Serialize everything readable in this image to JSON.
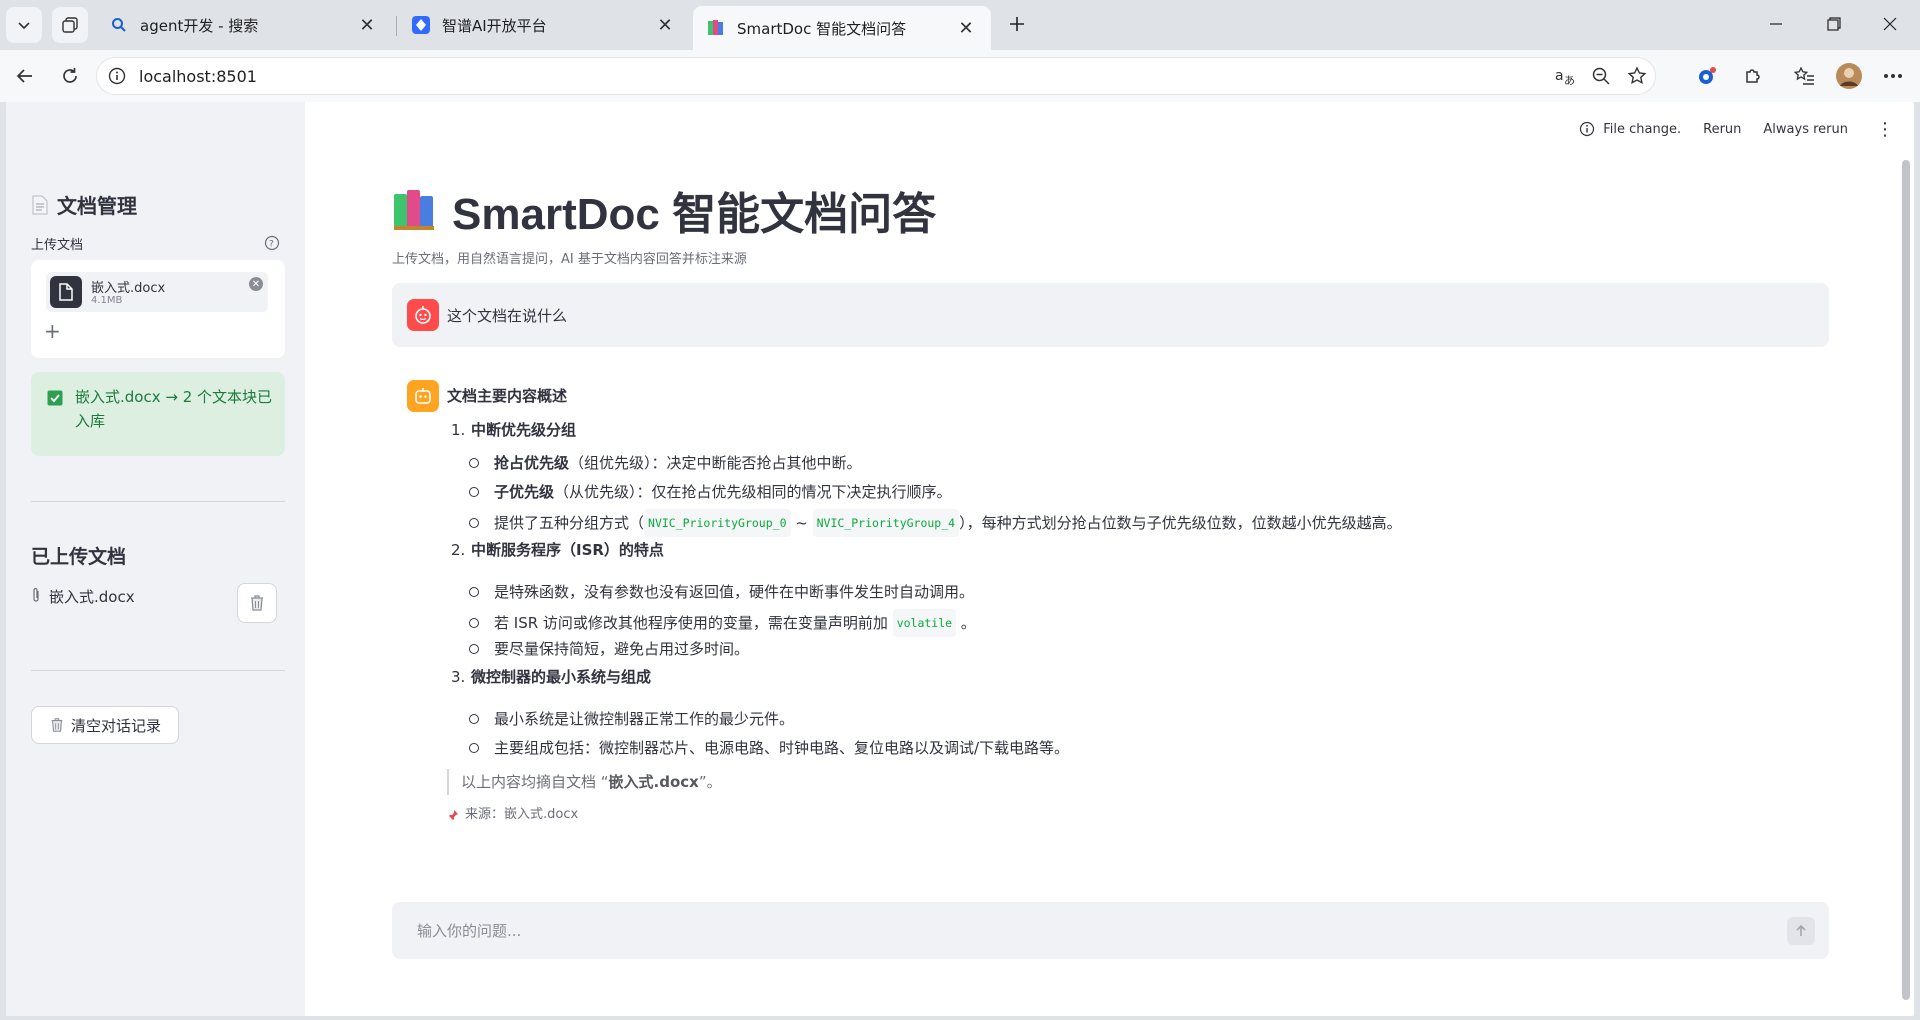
{
  "browser": {
    "tabs": [
      {
        "title": "agent开发 - 搜索",
        "icon": "search-icon"
      },
      {
        "title": "智谱AI开放平台",
        "icon": "zhipu-logo-icon"
      },
      {
        "title": "SmartDoc 智能文档问答",
        "icon": "books-icon",
        "active": true
      }
    ],
    "url": "localhost:8501"
  },
  "sidebar": {
    "doc_manage_title": "文档管理",
    "upload_label": "上传文档",
    "file_name": "嵌入式.docx",
    "file_size": "4.1MB",
    "add_symbol": "+",
    "success_text": "嵌入式.docx → 2 个文本块已入库",
    "uploaded_title": "已上传文档",
    "uploaded_file": "嵌入式.docx",
    "clear_button": "清空对话记录"
  },
  "topbar": {
    "status": "File change.",
    "rerun": "Rerun",
    "always_rerun": "Always rerun"
  },
  "main": {
    "title": "SmartDoc 智能文档问答",
    "subtitle": "上传文档，用自然语言提问，AI 基于文档内容回答并标注来源",
    "user_question": "这个文档在说什么",
    "answer": {
      "heading": "文档主要内容概述",
      "sections": [
        {
          "num": "1.",
          "title": "中断优先级分组",
          "items": [
            {
              "bold": "抢占优先级",
              "text": "（组优先级）：决定中断能否抢占其他中断。"
            },
            {
              "bold": "子优先级",
              "text": "（从优先级）：仅在抢占优先级相同的情况下决定执行顺序。"
            },
            {
              "pre": "提供了五种分组方式（",
              "code1": "NVIC_PriorityGroup_0",
              "mid": " ~ ",
              "code2": "NVIC_PriorityGroup_4",
              "post": "），每种方式划分抢占位数与子优先级位数，位数越小优先级越高。"
            }
          ]
        },
        {
          "num": "2.",
          "title": "中断服务程序（ISR）的特点",
          "items": [
            {
              "text": "是特殊函数，没有参数也没有返回值，硬件在中断事件发生时自动调用。"
            },
            {
              "pre": "若 ISR 访问或修改其他程序使用的变量，需在变量声明前加 ",
              "code1": "volatile",
              "post": " 。"
            },
            {
              "text": "要尽量保持简短，避免占用过多时间。"
            }
          ]
        },
        {
          "num": "3.",
          "title": "微控制器的最小系统与组成",
          "items": [
            {
              "text": "最小系统是让微控制器正常工作的最少元件。"
            },
            {
              "text": "主要组成包括：微控制器芯片、电源电路、时钟电路、复位电路以及调试/下载电路等。"
            }
          ]
        }
      ],
      "quote_pre": "以上内容均摘自文档 “",
      "quote_bold": "嵌入式.docx",
      "quote_post": "”。",
      "source": "来源：嵌入式.docx"
    },
    "input_placeholder": "输入你的问题..."
  }
}
